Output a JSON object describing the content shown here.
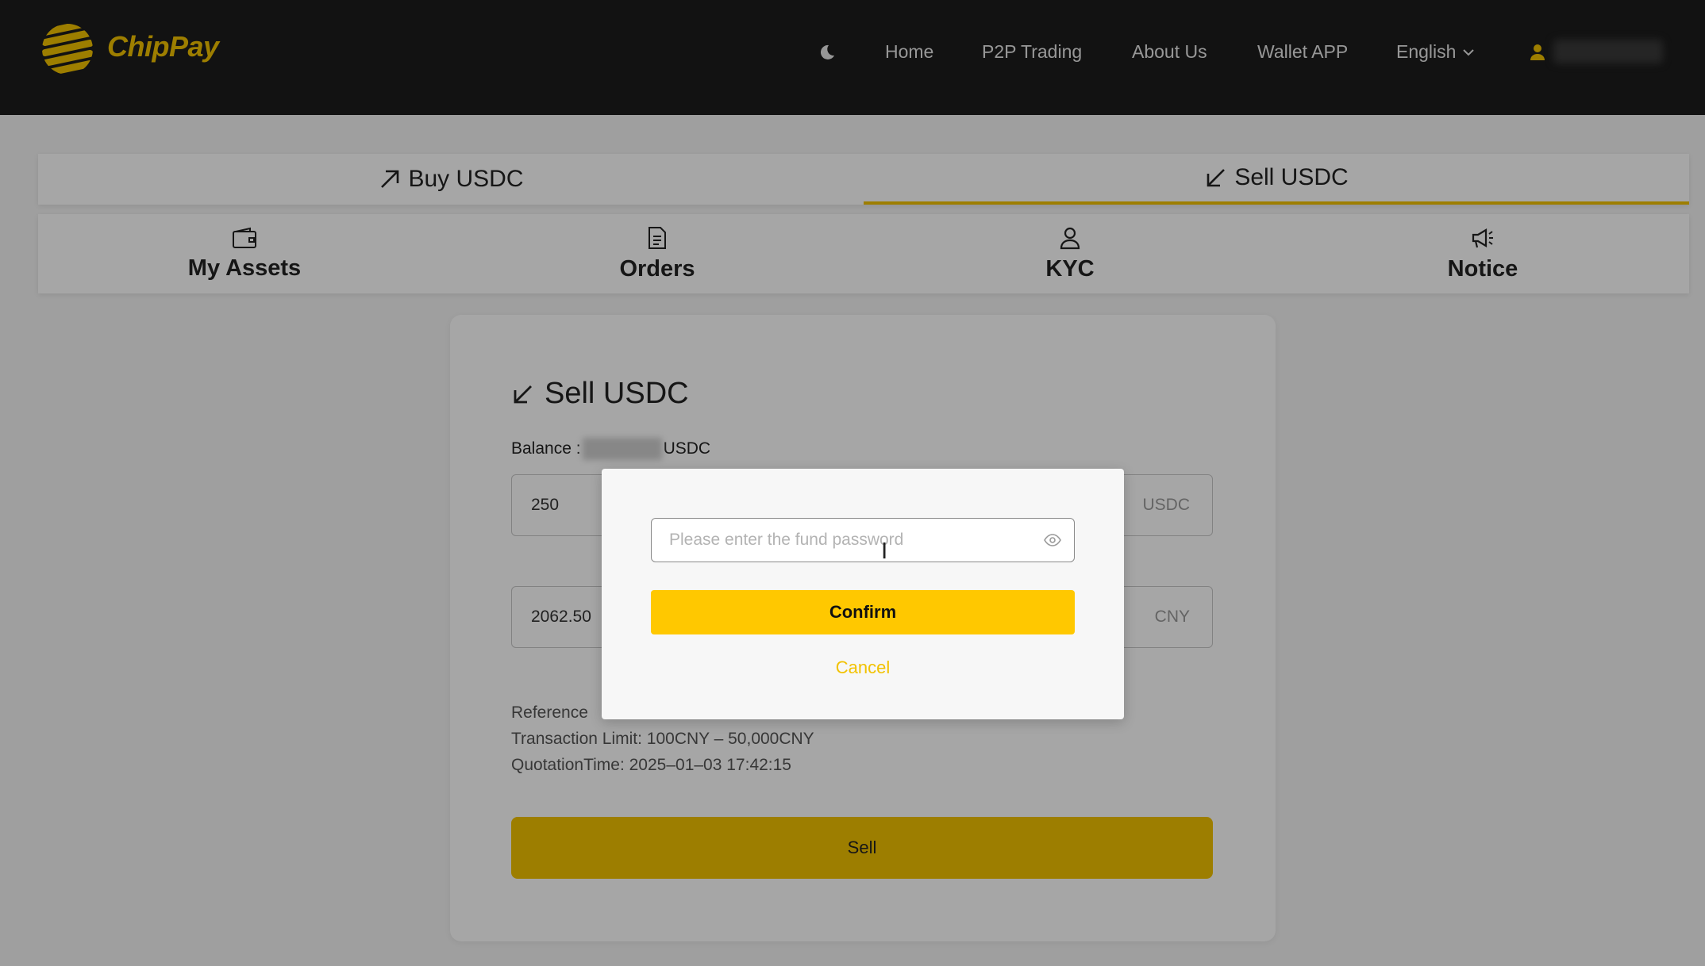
{
  "header": {
    "brand": "ChipPay",
    "nav": [
      "Home",
      "P2P Trading",
      "About Us",
      "Wallet APP"
    ],
    "language": "English"
  },
  "tabs": [
    {
      "label": "Buy USDC",
      "icon": "arrow-up-right-icon",
      "active": false
    },
    {
      "label": "Sell USDC",
      "icon": "arrow-down-left-icon",
      "active": true
    }
  ],
  "subnav": [
    {
      "label": "My Assets",
      "icon": "wallet-icon"
    },
    {
      "label": "Orders",
      "icon": "document-icon"
    },
    {
      "label": "KYC",
      "icon": "user-icon"
    },
    {
      "label": "Notice",
      "icon": "megaphone-icon"
    }
  ],
  "sell_card": {
    "title": "Sell USDC",
    "balance_label": "Balance :",
    "balance_unit": "USDC",
    "amount_value": "250",
    "amount_unit": "USDC",
    "total_value": "2062.50",
    "total_unit": "CNY",
    "reference_label": "Reference",
    "limit_text": "Transaction Limit: 100CNY – 50,000CNY",
    "quotation_time": "QuotationTime: 2025–01–03 17:42:15",
    "sell_label": "Sell"
  },
  "modal": {
    "password_placeholder": "Please enter the fund password",
    "confirm_label": "Confirm",
    "cancel_label": "Cancel"
  },
  "colors": {
    "accent": "#f2c200",
    "header_bg": "#1c1c1c",
    "confirm": "#ffc800"
  }
}
